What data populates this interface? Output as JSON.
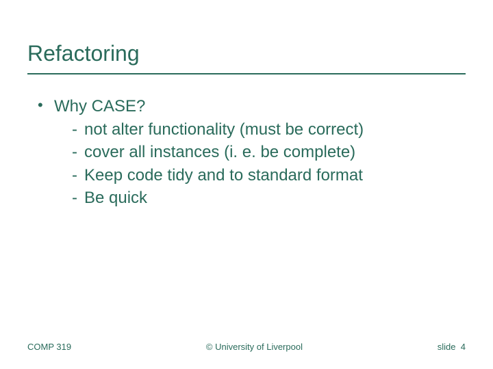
{
  "title": "Refactoring",
  "bullet": {
    "label": "Why CASE?",
    "subitems": [
      "not alter functionality (must be correct)",
      "cover all instances (i. e. be complete)",
      "Keep code tidy and to standard format",
      "Be quick"
    ]
  },
  "footer": {
    "left": "COMP 319",
    "center": "© University of Liverpool",
    "right_prefix": "slide",
    "right_number": "4"
  }
}
